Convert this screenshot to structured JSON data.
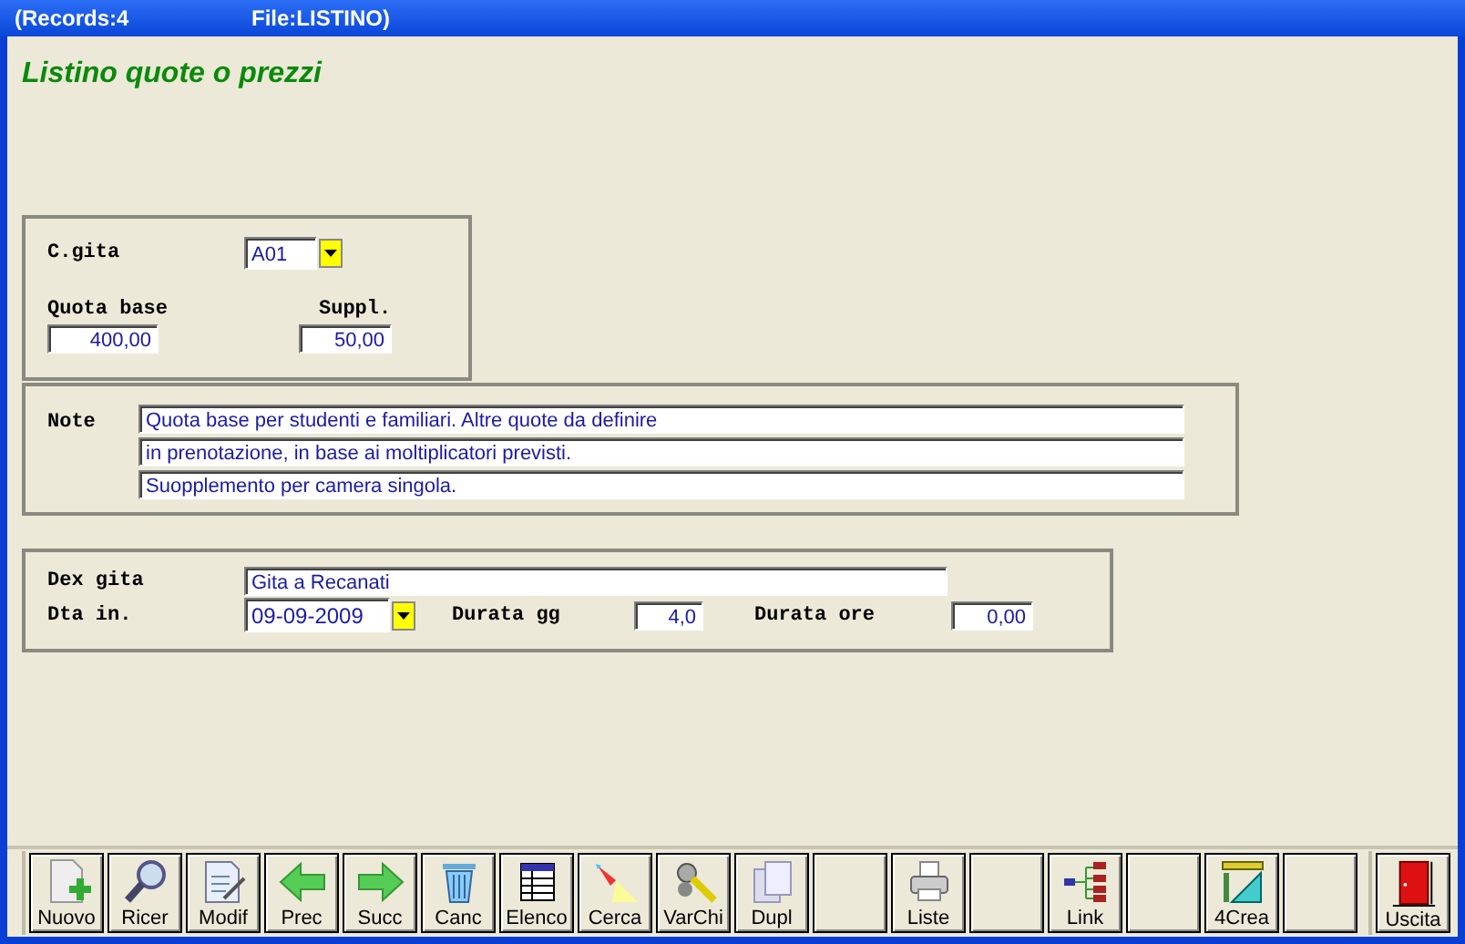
{
  "window": {
    "records": "(Records:4",
    "file": "File:LISTINO)"
  },
  "form_title": "Listino quote o prezzi",
  "header": {
    "code_label": "C.gita",
    "code_value": "A01",
    "base_label": "Quota base",
    "base_value": "400,00",
    "suppl_label": "Suppl.",
    "suppl_value": "50,00"
  },
  "notes": {
    "label": "Note",
    "lines": [
      "Quota base per studenti e familiari. Altre quote da definire",
      "in prenotazione, in base ai moltiplicatori previsti.",
      "Suopplemento per camera singola."
    ]
  },
  "trip": {
    "desc_label": "Dex gita",
    "desc_value": "Gita a Recanati",
    "date_label": "Dta in.",
    "date_value": "09-09-2009",
    "days_label": "Durata gg",
    "days_value": "4,0",
    "hours_label": "Durata ore",
    "hours_value": "0,00"
  },
  "toolbar": [
    {
      "kind": "new",
      "label": "Nuovo"
    },
    {
      "kind": "find",
      "label": "Ricer"
    },
    {
      "kind": "edit",
      "label": "Modif"
    },
    {
      "kind": "prev",
      "label": "Prec"
    },
    {
      "kind": "next",
      "label": "Succ"
    },
    {
      "kind": "delete",
      "label": "Canc"
    },
    {
      "kind": "list",
      "label": "Elenco"
    },
    {
      "kind": "torch",
      "label": "Cerca"
    },
    {
      "kind": "keys",
      "label": "VarChi"
    },
    {
      "kind": "copy",
      "label": "Dupl"
    },
    {
      "kind": "blank"
    },
    {
      "kind": "print",
      "label": "Liste"
    },
    {
      "kind": "blank"
    },
    {
      "kind": "link",
      "label": "Link"
    },
    {
      "kind": "blank"
    },
    {
      "kind": "tools",
      "label": "4Crea"
    },
    {
      "kind": "blank"
    },
    {
      "kind": "exit",
      "label": "Uscita"
    }
  ]
}
